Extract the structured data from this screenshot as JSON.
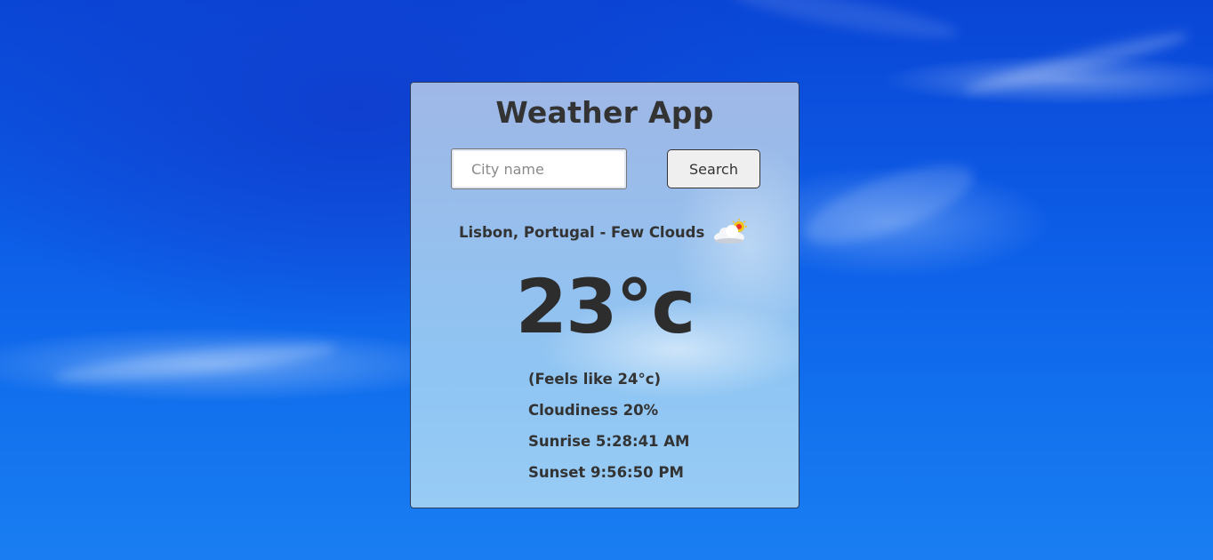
{
  "app": {
    "title": "Weather App"
  },
  "search": {
    "placeholder": "City name",
    "value": "",
    "button_label": "Search"
  },
  "weather": {
    "location": "Lisbon, Portugal - Few Clouds",
    "icon": "few-clouds-icon",
    "temperature": "23°c",
    "feels_like": "(Feels like 24°c)",
    "cloudiness": "Cloudiness 20%",
    "sunrise": "Sunrise 5:28:41 AM",
    "sunset": "Sunset 9:56:50 PM"
  },
  "colors": {
    "background": "#0d5fe8",
    "card": "#95c0ee",
    "text": "#333333"
  }
}
